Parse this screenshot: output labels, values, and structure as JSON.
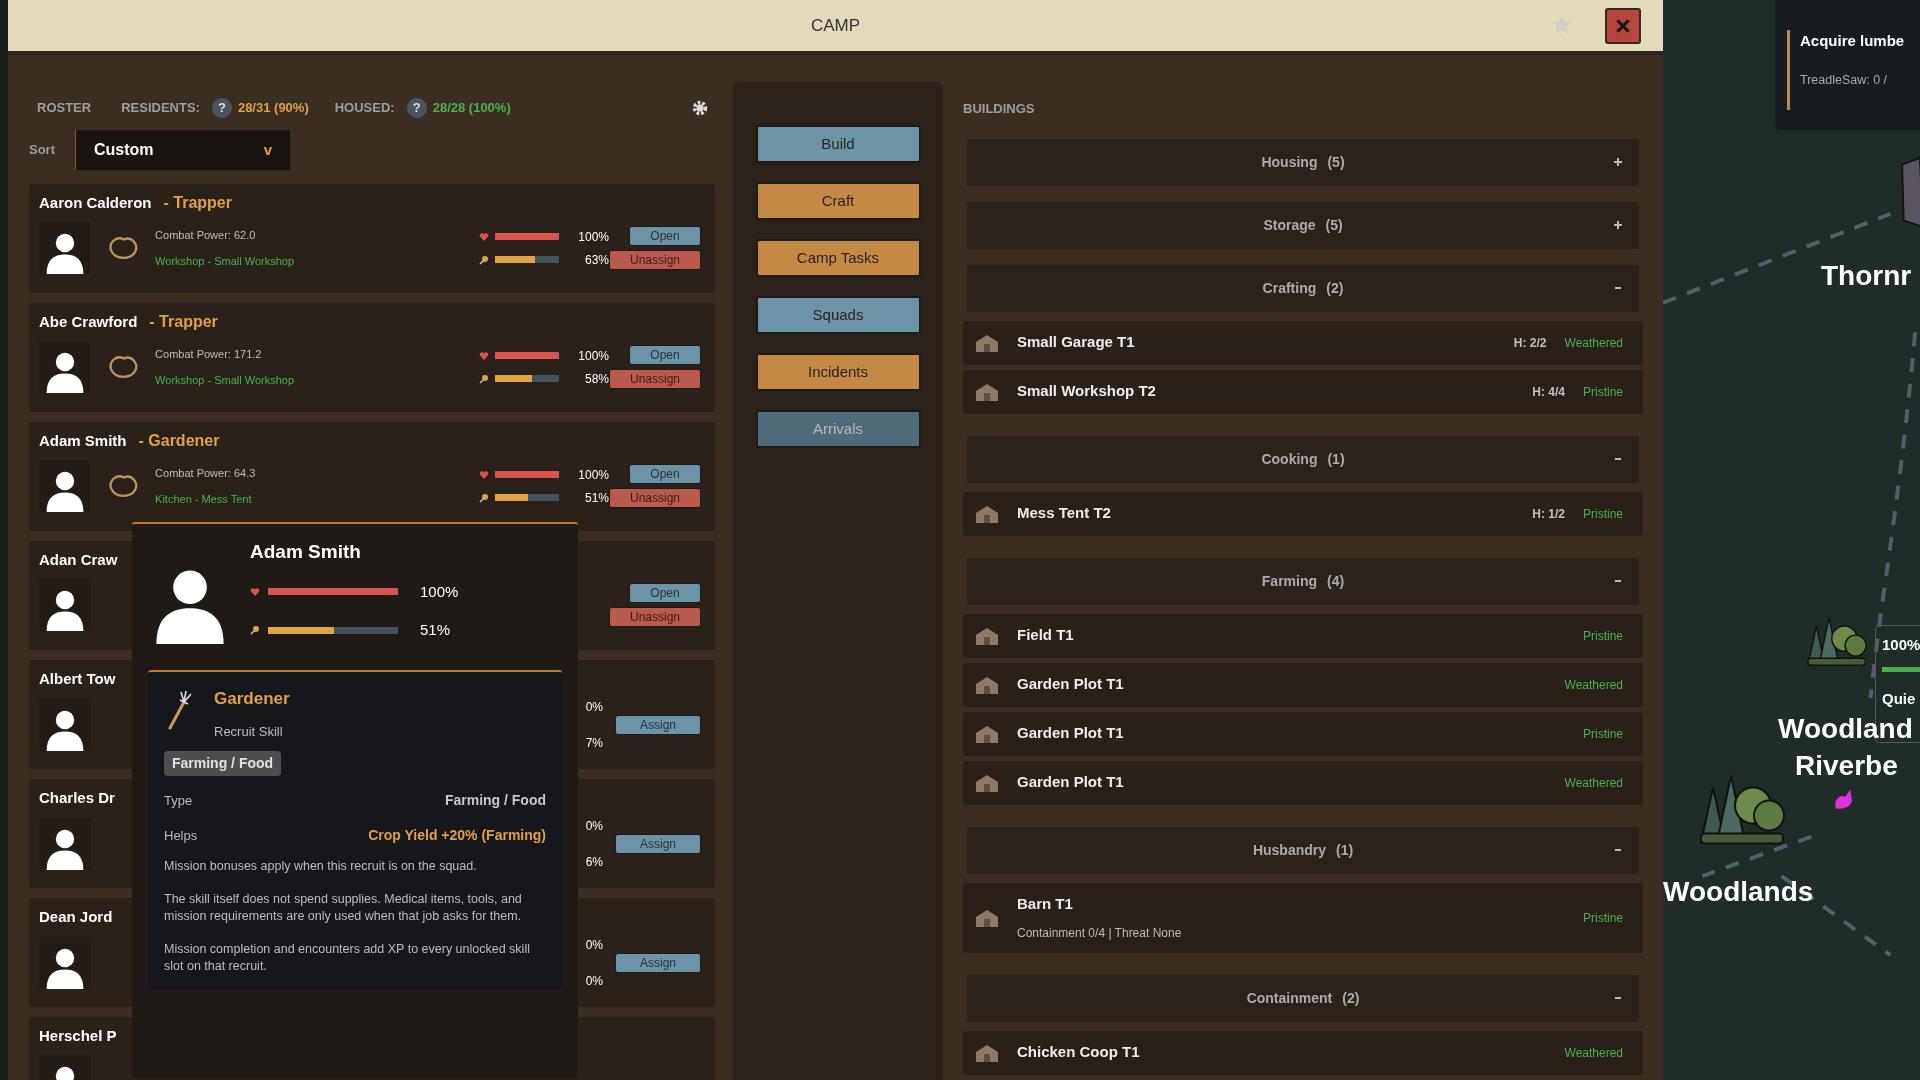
{
  "window": {
    "title": "CAMP"
  },
  "roster": {
    "label": "ROSTER",
    "residents_label": "RESIDENTS:",
    "residents_help": "?",
    "residents": "28/31 (90%)",
    "housed_label": "HOUSED:",
    "housed_help": "?",
    "housed": "28/28 (100%)",
    "sort": {
      "label": "Sort",
      "value": "Custom",
      "caret": "v"
    },
    "recruits": [
      {
        "kind": "full",
        "name": "Aaron Calderon",
        "role": "- Trapper",
        "combat": "Combat Power: 62.0",
        "job": "Workshop - Small Workshop",
        "health": {
          "level": 1,
          "reading": "100%"
        },
        "energy": {
          "level": 0.63,
          "reading": "63%"
        },
        "buttons": [
          {
            "label": "Open",
            "kind": "open"
          },
          {
            "label": "Unassign",
            "kind": "unassign"
          }
        ]
      },
      {
        "kind": "full",
        "name": "Abe Crawford",
        "role": "- Trapper",
        "combat": "Combat Power: 171.2",
        "job": "Workshop - Small Workshop",
        "health": {
          "level": 1,
          "reading": "100%"
        },
        "energy": {
          "level": 0.58,
          "reading": "58%"
        },
        "buttons": [
          {
            "label": "Open",
            "kind": "open"
          },
          {
            "label": "Unassign",
            "kind": "unassign"
          }
        ]
      },
      {
        "kind": "full",
        "name": "Adam Smith",
        "role": "- Gardener",
        "combat": "Combat Power: 64.3",
        "job": "Kitchen - Mess Tent",
        "health": {
          "level": 1,
          "reading": "100%"
        },
        "energy": {
          "level": 0.51,
          "reading": "51%"
        },
        "buttons": [
          {
            "label": "Open",
            "kind": "open"
          },
          {
            "label": "Unassign",
            "kind": "unassign"
          }
        ]
      },
      {
        "kind": "covered",
        "name": "Adan Craw",
        "buttons": [
          {
            "label": "Open",
            "kind": "open"
          },
          {
            "label": "Unassign",
            "kind": "unassign"
          }
        ]
      },
      {
        "kind": "covered",
        "name": "Albert Tow",
        "readings": [
          "0%",
          "7%"
        ],
        "buttons": [
          {
            "label": "Assign",
            "kind": "assign"
          }
        ]
      },
      {
        "kind": "covered",
        "name": "Charles Dr",
        "readings": [
          "0%",
          "6%"
        ],
        "buttons": [
          {
            "label": "Assign",
            "kind": "assign"
          }
        ]
      },
      {
        "kind": "covered",
        "name": "Dean Jord",
        "readings": [
          "0%",
          "0%"
        ],
        "buttons": [
          {
            "label": "Assign",
            "kind": "assign"
          }
        ]
      },
      {
        "kind": "covered",
        "name": "Herschel P"
      }
    ]
  },
  "tooltip": {
    "name": "Adam Smith",
    "health": {
      "level": 1,
      "reading": "100%"
    },
    "energy": {
      "level": 0.51,
      "reading": "51%"
    },
    "skill": {
      "title": "Gardener",
      "subtitle": "Recruit Skill",
      "tag": "Farming / Food",
      "rows": [
        {
          "label": "Type",
          "value": "Farming / Food",
          "highlight": false
        },
        {
          "label": "Helps",
          "value": "Crop Yield +20% (Farming)",
          "highlight": true
        }
      ],
      "paragraphs": [
        "Mission bonuses apply when this recruit is on the squad.",
        "The skill itself does not spend supplies. Medical items, tools, and mission requirements are only used when that job asks for them.",
        "Mission completion and encounters add XP to every unlocked skill slot on that recruit."
      ]
    }
  },
  "actions": [
    {
      "label": "Build",
      "color": "#6d93a7",
      "disabled": false
    },
    {
      "label": "Craft",
      "color": "#c48a45",
      "disabled": false
    },
    {
      "label": "Camp Tasks",
      "color": "#c48a45",
      "disabled": false
    },
    {
      "label": "Squads",
      "color": "#6d93a7",
      "disabled": false
    },
    {
      "label": "Incidents",
      "color": "#c48a45",
      "disabled": false
    },
    {
      "label": "Arrivals",
      "color": "#4f6b79",
      "disabled": true
    }
  ],
  "buildings": {
    "title": "BUILDINGS",
    "entries": [
      {
        "kind": "section",
        "title": "Housing",
        "count": "(5)",
        "expanded": false
      },
      {
        "kind": "section",
        "title": "Storage",
        "count": "(5)",
        "expanded": false
      },
      {
        "kind": "section",
        "title": "Crafting",
        "count": "(2)",
        "expanded": true
      },
      {
        "kind": "building",
        "name": "Small Garage T1",
        "hp": "H: 2/2",
        "condition": "Weathered"
      },
      {
        "kind": "building",
        "name": "Small Workshop T2",
        "hp": "H: 4/4",
        "condition": "Pristine"
      },
      {
        "kind": "section",
        "title": "Cooking",
        "count": "(1)",
        "expanded": true
      },
      {
        "kind": "building",
        "name": "Mess Tent T2",
        "hp": "H: 1/2",
        "condition": "Pristine"
      },
      {
        "kind": "section",
        "title": "Farming",
        "count": "(4)",
        "expanded": true
      },
      {
        "kind": "building",
        "name": "Field T1",
        "condition": "Pristine"
      },
      {
        "kind": "building",
        "name": "Garden Plot T1",
        "condition": "Weathered"
      },
      {
        "kind": "building",
        "name": "Garden Plot T1",
        "condition": "Pristine"
      },
      {
        "kind": "building",
        "name": "Garden Plot T1",
        "condition": "Weathered"
      },
      {
        "kind": "section",
        "title": "Husbandry",
        "count": "(1)",
        "expanded": true
      },
      {
        "kind": "building",
        "name": "Barn T1",
        "detail": "Containment 0/4 | Threat None",
        "condition": "Pristine"
      },
      {
        "kind": "section",
        "title": "Containment",
        "count": "(2)",
        "expanded": true
      },
      {
        "kind": "building",
        "name": "Chicken Coop T1",
        "condition": "Weathered"
      }
    ]
  },
  "map": {
    "quest": {
      "title": "Acquire lumbe",
      "detail": "TreadleSaw: 0 /"
    },
    "labels": [
      "Thornr",
      "Woodland",
      "Riverbe",
      "Woodlands"
    ],
    "info": {
      "reading": "100%",
      "level": 1,
      "status": "Quie"
    }
  }
}
